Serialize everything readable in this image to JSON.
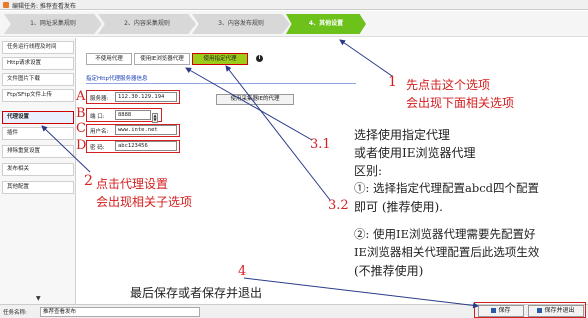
{
  "window": {
    "title": "编辑任务: 推荐查看发布"
  },
  "steps": [
    "1、网址采集规则",
    "2、内容采集规则",
    "3、内容发布规则",
    "4、其他设置"
  ],
  "sidebar": {
    "items": [
      "任务运行线程及时间",
      "Http请求设置",
      "文件图片下载",
      "Ftp/SFtp文件上传",
      "代理设置",
      "插件",
      "排除重复设置",
      "发布相关",
      "其他配置"
    ],
    "scroll_glyph": "▼"
  },
  "tabs": [
    "不使用代理",
    "使用IE浏览器代理",
    "使用指定代理"
  ],
  "info_glyph": "i",
  "section": {
    "title": "指定Http代理服务器信息"
  },
  "form": {
    "server_label": "服务器:",
    "server_value": "112.30.129.194",
    "port_label": "端 口:",
    "port_value": "8888",
    "user_label": "用户名:",
    "user_value": "www.inte.net",
    "pass_label": "密 码:",
    "pass_value": "abc123456",
    "ie_button": "使用采集器IE的代理"
  },
  "letters": {
    "a": "A",
    "b": "B",
    "c": "C",
    "d": "D"
  },
  "annotations": {
    "n1_num": "1",
    "n1_line1": "先点击这个选项",
    "n1_line2": "会出现下面相关选项",
    "n2_num": "2",
    "n2_line1": "点击代理设置",
    "n2_line2": "会出现相关子选项",
    "n31": "3.1",
    "n32": "3.2",
    "n4": "4",
    "desc_1": "选择使用指定代理",
    "desc_2": "或者使用IE浏览器代理",
    "desc_3": "区别:",
    "desc_4": "①: 选择指定代理配置abcd四个配置",
    "desc_5": "即可 (推荐使用).",
    "desc_6": "②: 使用IE浏览器代理需要先配置好",
    "desc_7": "IE浏览器相关代理配置后此选项生效",
    "desc_8": "(不推荐使用)",
    "save_hint": "最后保存或者保存并退出"
  },
  "bottom": {
    "name_label": "任务名称:",
    "name_value": "推荐查看发布",
    "save": "保存",
    "save_exit": "保存并退出"
  },
  "colors": {
    "accent_green": "#6cc21a",
    "annotation_red": "#d42020",
    "link_blue": "#1a3fb8"
  }
}
